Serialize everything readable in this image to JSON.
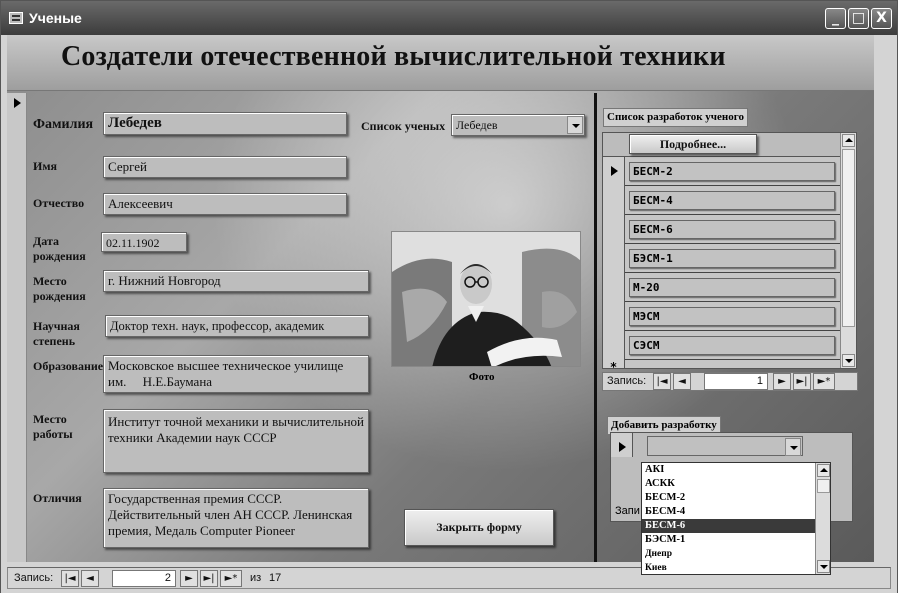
{
  "window": {
    "title": "Ученые",
    "minimize": "_",
    "maximize": "□",
    "close": "X"
  },
  "header": {
    "title": "Создатели отечественной вычислительной техники"
  },
  "fields": {
    "surname": {
      "label": "Фамилия",
      "value": "Лебедев"
    },
    "name": {
      "label": "Имя",
      "value": "Сергей"
    },
    "patronymic": {
      "label": "Отчество",
      "value": "Алексеевич"
    },
    "birth_date": {
      "label": "Дата рождения",
      "value": "02.11.1902"
    },
    "birth_place": {
      "label": "Место рождения",
      "value": "г. Нижний Новгород"
    },
    "degree": {
      "label": "Научная степень",
      "value": "Доктор техн. наук, профессор, академик"
    },
    "education": {
      "label": "Образование",
      "value": "Московское высшее техническое училище им.     Н.Е.Баумана"
    },
    "work": {
      "label": "Место работы",
      "value": "Институт точной механики и вычислительной техники Академии наук СССР"
    },
    "awards": {
      "label": "Отличия",
      "value": "Государственная премия СССР. Действительный член АН СССР. Ленинская премия, Медаль Computer Pioneer"
    }
  },
  "scientist_list": {
    "label": "Список ученых",
    "value": "Лебедев"
  },
  "photo": {
    "caption": "Фото"
  },
  "close_button": {
    "label": "Закрыть форму"
  },
  "developments": {
    "label": "Список разработок ученого",
    "details_button": "Подробнее...",
    "rows": [
      "БЕСМ-2",
      "БЕСМ-4",
      "БЕСМ-6",
      "БЭСМ-1",
      "М-20",
      "МЭСМ",
      "СЭСМ"
    ],
    "new_row_marker": "*",
    "nav": {
      "caption": "Запись:",
      "current": "1"
    }
  },
  "add_development": {
    "label": "Добавить разработку",
    "partial_caption": "Запи",
    "options": [
      "АКI",
      "АСКК",
      "БЕСМ-2",
      "БЕСМ-4",
      "БЕСМ-6",
      "БЭСМ-1",
      "Днепр",
      "Киев"
    ],
    "highlighted": "БЕСМ-6"
  },
  "record_nav": {
    "caption": "Запись:",
    "current": "2",
    "of_label": "из",
    "total": "17"
  },
  "nav_glyphs": {
    "first": "|◄",
    "prev": "◄",
    "next": "►",
    "last": "►|",
    "new": "►*"
  },
  "colors": {
    "title_bar": "#4a4a4a",
    "form_bg": "#8a8a8a",
    "field_bg": "#bdbdbd",
    "highlight": "#3a3a3a"
  }
}
